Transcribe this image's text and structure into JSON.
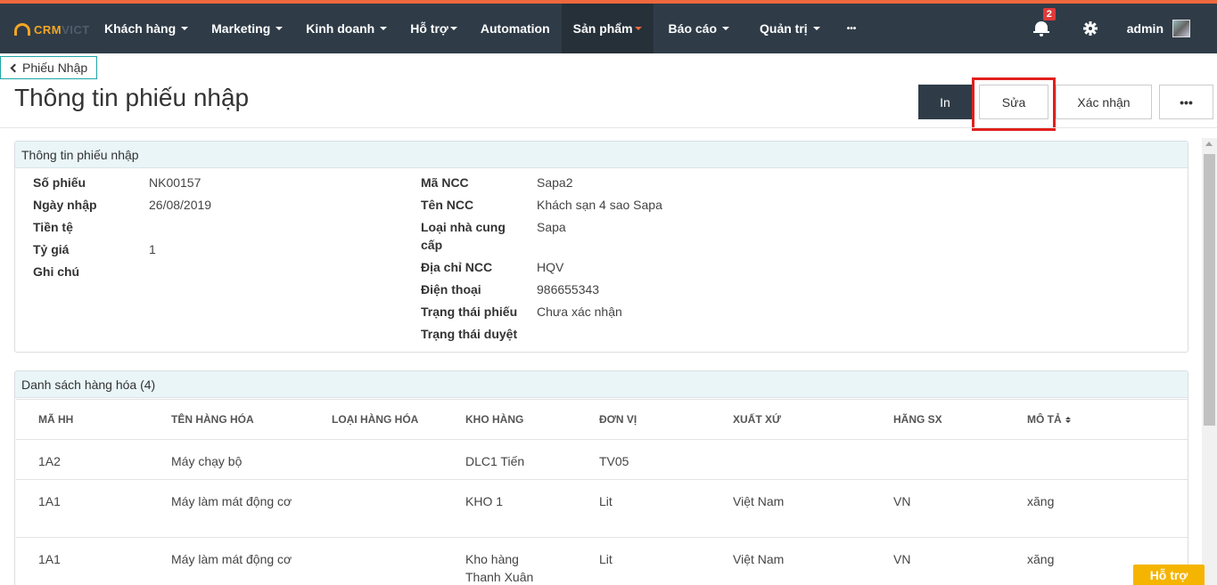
{
  "nav": {
    "logo": {
      "brand": "CRM",
      "suffix": "VICT"
    },
    "items": [
      {
        "label": "Khách hàng",
        "caret": true
      },
      {
        "label": "Marketing",
        "caret": true
      },
      {
        "label": "Kinh doanh",
        "caret": true
      },
      {
        "label": "Hỗ trợ",
        "caret": true
      },
      {
        "label": "Automation",
        "caret": false
      },
      {
        "label": "Sản phẩm",
        "caret": true,
        "active": true
      },
      {
        "label": "Báo cáo",
        "caret": true
      },
      {
        "label": "Quản trị",
        "caret": true
      },
      {
        "label": "•••",
        "caret": false
      }
    ],
    "notification_count": "2",
    "username": "admin"
  },
  "header": {
    "back_label": "Phiếu Nhập",
    "title": "Thông tin phiếu nhập",
    "actions": {
      "print": "In",
      "edit": "Sửa",
      "confirm": "Xác nhận",
      "more": "•••"
    }
  },
  "info": {
    "title": "Thông tin phiếu nhập",
    "left": {
      "so_phieu": {
        "label": "Số phiếu",
        "value": "NK00157"
      },
      "ngay_nhap": {
        "label": "Ngày nhập",
        "value": "26/08/2019"
      },
      "tien_te": {
        "label": "Tiền tệ",
        "value": ""
      },
      "ty_gia": {
        "label": "Tỷ giá",
        "value": "1"
      },
      "ghi_chu": {
        "label": "Ghi chú",
        "value": ""
      }
    },
    "right": {
      "ma_ncc": {
        "label": "Mã NCC",
        "value": "Sapa2"
      },
      "ten_ncc": {
        "label": "Tên NCC",
        "value": "Khách sạn 4 sao Sapa"
      },
      "loai_ncc": {
        "label": "Loại nhà cung cấp",
        "value": "Sapa"
      },
      "dia_chi": {
        "label": "Địa chỉ NCC",
        "value": "HQV"
      },
      "dien_thoai": {
        "label": "Điện thoại",
        "value": "986655343"
      },
      "trang_thai_phieu": {
        "label": "Trạng thái phiếu",
        "value": "Chưa xác nhận"
      },
      "trang_thai_duyet": {
        "label": "Trạng thái duyệt",
        "value": ""
      }
    }
  },
  "goods": {
    "title": "Danh sách hàng hóa (4)",
    "columns": [
      "MÃ HH",
      "TÊN HÀNG HÓA",
      "LOẠI HÀNG HÓA",
      "KHO HÀNG",
      "ĐƠN VỊ",
      "XUẤT XỨ",
      "HÃNG SX",
      "MÔ TẢ"
    ],
    "rows": [
      [
        "1A2",
        "Máy chạy bộ",
        "",
        "DLC1 Tiến",
        "TV05",
        "",
        "",
        ""
      ],
      [
        "1A1",
        "Máy làm mát động cơ",
        "",
        "KHO 1",
        "Lit",
        "Việt Nam",
        "VN",
        "xăng"
      ],
      [
        "1A1",
        "Máy làm mát động cơ",
        "",
        "Kho hàng Thanh Xuân",
        "Lit",
        "Việt Nam",
        "VN",
        "xăng"
      ]
    ]
  },
  "help_label": "Hỗ trợ"
}
